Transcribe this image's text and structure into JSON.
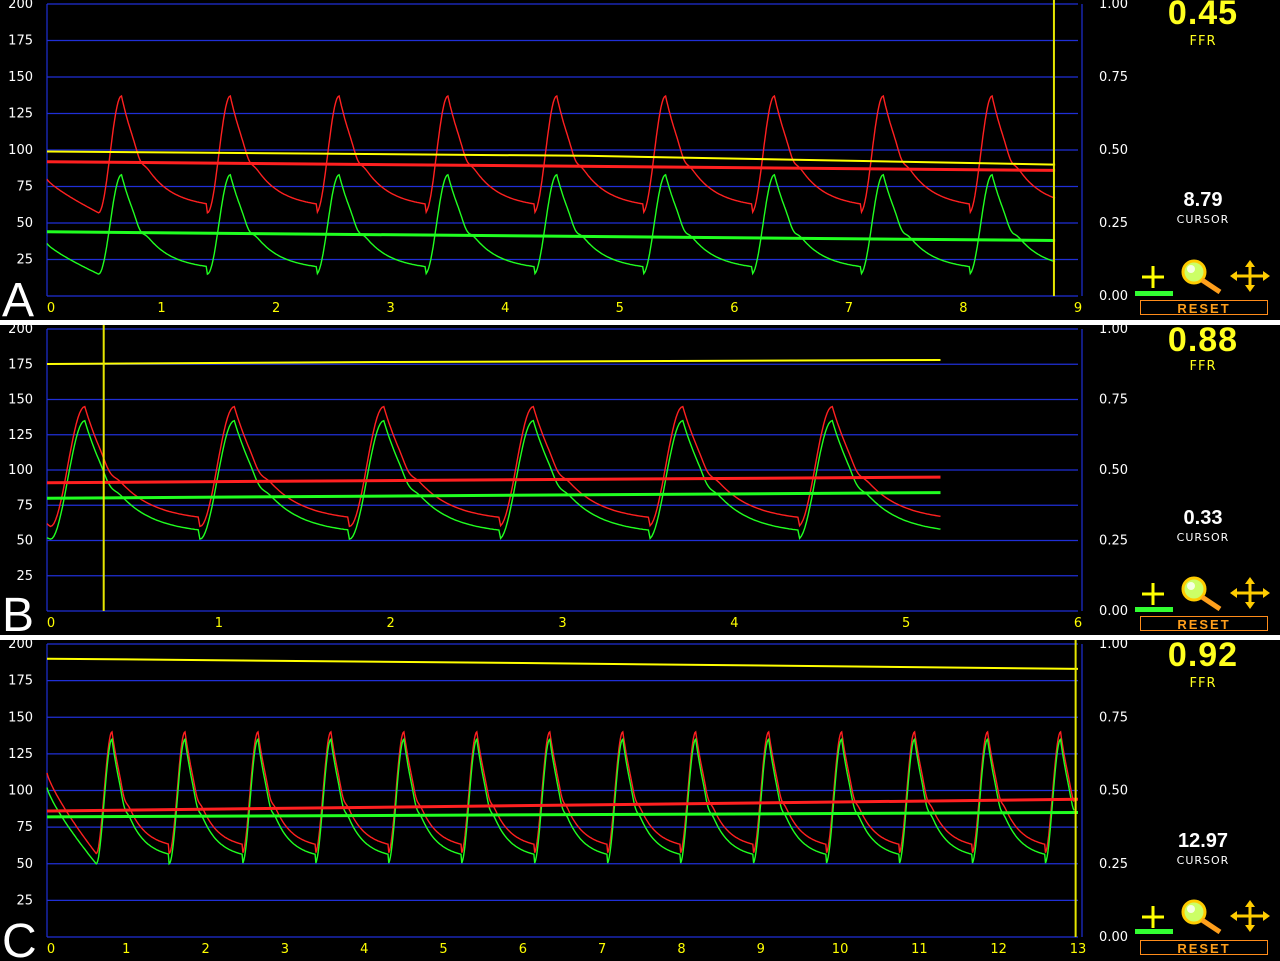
{
  "chart_data": [
    {
      "type": "line",
      "panel_label": "A",
      "x_ticks": [
        "0",
        "1",
        "2",
        "3",
        "4",
        "5",
        "6",
        "7",
        "8",
        "9"
      ],
      "xlim": [
        0,
        9
      ],
      "y_left_ticks": [
        "25",
        "50",
        "75",
        "100",
        "125",
        "150",
        "175",
        "200"
      ],
      "ylim_left": [
        0,
        200
      ],
      "y_right_ticks": [
        "0.00",
        "0.25",
        "0.50",
        "0.75",
        "1.00"
      ],
      "ylim_right": [
        0,
        1
      ],
      "grid": true,
      "cursor_x": 8.79,
      "ffr_value": "0.45",
      "ffr_label": "FFR",
      "cursor_value": "8.79",
      "cursor_label": "CURSOR",
      "reset_label": "RESET",
      "beats": {
        "first_foot": 0.45,
        "period": 0.95,
        "count": 10,
        "t_end": 8.8
      },
      "aortic": {
        "color": "#ff2020",
        "foot": 57,
        "peak": 137,
        "t_start": 0.0,
        "v_start": 80
      },
      "distal": {
        "color": "#20ff20",
        "foot": 15,
        "peak": 83,
        "t_start": 0.0,
        "v_start": 36
      },
      "aortic_mean": {
        "color": "#ff2020",
        "points": [
          [
            0,
            92
          ],
          [
            8.8,
            86
          ]
        ]
      },
      "distal_mean": {
        "color": "#20ff20",
        "points": [
          [
            0,
            44
          ],
          [
            8.8,
            38
          ]
        ]
      },
      "ffr_trace": {
        "color": "#ffff00",
        "points": [
          [
            0,
            0.495
          ],
          [
            4.7,
            0.48
          ],
          [
            8.8,
            0.45
          ]
        ]
      }
    },
    {
      "type": "line",
      "panel_label": "B",
      "x_ticks": [
        "0",
        "1",
        "2",
        "3",
        "4",
        "5",
        "6"
      ],
      "xlim": [
        0,
        6
      ],
      "y_left_ticks": [
        "25",
        "50",
        "75",
        "100",
        "125",
        "150",
        "175",
        "200"
      ],
      "ylim_left": [
        0,
        200
      ],
      "y_right_ticks": [
        "0.00",
        "0.25",
        "0.50",
        "0.75",
        "1.00"
      ],
      "ylim_right": [
        0,
        1
      ],
      "grid": true,
      "cursor_x": 0.33,
      "ffr_value": "0.88",
      "ffr_label": "FFR",
      "cursor_value": "0.33",
      "cursor_label": "CURSOR",
      "reset_label": "RESET",
      "beats": {
        "first_foot": 0.02,
        "period": 0.87,
        "count": 6,
        "t_end": 5.2
      },
      "aortic": {
        "color": "#ff2020",
        "foot": 60,
        "peak": 145,
        "t_start": 0.0,
        "v_start": 62
      },
      "distal": {
        "color": "#20ff20",
        "foot": 51,
        "peak": 135,
        "t_start": 0.0,
        "v_start": 52
      },
      "aortic_mean": {
        "color": "#ff2020",
        "points": [
          [
            0,
            91
          ],
          [
            5.2,
            95
          ]
        ]
      },
      "distal_mean": {
        "color": "#20ff20",
        "points": [
          [
            0,
            80
          ],
          [
            5.2,
            84
          ]
        ]
      },
      "ffr_trace": {
        "color": "#ffff00",
        "points": [
          [
            0,
            0.876
          ],
          [
            2.0,
            0.883
          ],
          [
            5.2,
            0.89
          ]
        ]
      }
    },
    {
      "type": "line",
      "panel_label": "C",
      "x_ticks": [
        "0",
        "1",
        "2",
        "3",
        "4",
        "5",
        "6",
        "7",
        "8",
        "9",
        "10",
        "11",
        "12",
        "13"
      ],
      "xlim": [
        0,
        13
      ],
      "y_left_ticks": [
        "25",
        "50",
        "75",
        "100",
        "125",
        "150",
        "175",
        "200"
      ],
      "ylim_left": [
        0,
        200
      ],
      "y_right_ticks": [
        "0.00",
        "0.25",
        "0.50",
        "0.75",
        "1.00"
      ],
      "ylim_right": [
        0,
        1
      ],
      "grid": true,
      "cursor_x": 12.97,
      "ffr_value": "0.92",
      "ffr_label": "FFR",
      "cursor_value": "12.97",
      "cursor_label": "CURSOR",
      "reset_label": "RESET",
      "beats": {
        "first_foot": 0.62,
        "period": 0.92,
        "count": 14,
        "t_end": 12.95
      },
      "aortic": {
        "color": "#ff2020",
        "foot": 57,
        "peak": 140,
        "t_start": 0.0,
        "v_start": 112
      },
      "distal": {
        "color": "#20ff20",
        "foot": 50,
        "peak": 135,
        "t_start": 0.0,
        "v_start": 102
      },
      "aortic_mean": {
        "color": "#ff2020",
        "points": [
          [
            0,
            86
          ],
          [
            13,
            94
          ]
        ]
      },
      "distal_mean": {
        "color": "#20ff20",
        "points": [
          [
            0,
            82
          ],
          [
            13,
            85
          ]
        ]
      },
      "ffr_trace": {
        "color": "#ffff00",
        "points": [
          [
            0,
            0.95
          ],
          [
            6,
            0.935
          ],
          [
            13,
            0.915
          ]
        ]
      }
    }
  ]
}
